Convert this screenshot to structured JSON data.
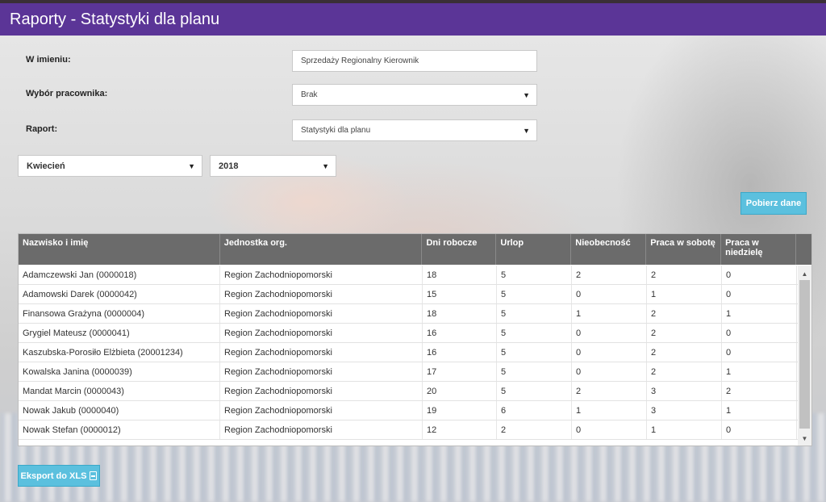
{
  "header": {
    "title": "Raporty - Statystyki dla planu"
  },
  "form": {
    "on_behalf_label": "W imieniu:",
    "on_behalf_value": "Sprzedaży Regionalny Kierownik",
    "employee_label": "Wybór pracownika:",
    "employee_value": "Brak",
    "report_label": "Raport:",
    "report_value": "Statystyki dla planu",
    "month_value": "Kwiecień",
    "year_value": "2018"
  },
  "buttons": {
    "fetch_label": "Pobierz dane",
    "export_label": "Eksport do XLS"
  },
  "table": {
    "columns": [
      "Nazwisko i imię",
      "Jednostka org.",
      "Dni robocze",
      "Urlop",
      "Nieobecność",
      "Praca w sobotę",
      "Praca w niedzielę"
    ],
    "rows": [
      [
        "Adamczewski Jan (0000018)",
        "Region Zachodniopomorski",
        "18",
        "5",
        "2",
        "2",
        "0"
      ],
      [
        "Adamowski Darek (0000042)",
        "Region Zachodniopomorski",
        "15",
        "5",
        "0",
        "1",
        "0"
      ],
      [
        "Finansowa Grażyna (0000004)",
        "Region Zachodniopomorski",
        "18",
        "5",
        "1",
        "2",
        "1"
      ],
      [
        "Grygiel Mateusz (0000041)",
        "Region Zachodniopomorski",
        "16",
        "5",
        "0",
        "2",
        "0"
      ],
      [
        "Kaszubska-Porosiło Elżbieta (20001234)",
        "Region Zachodniopomorski",
        "16",
        "5",
        "0",
        "2",
        "0"
      ],
      [
        "Kowalska Janina (0000039)",
        "Region Zachodniopomorski",
        "17",
        "5",
        "0",
        "2",
        "1"
      ],
      [
        "Mandat Marcin (0000043)",
        "Region Zachodniopomorski",
        "20",
        "5",
        "2",
        "3",
        "2"
      ],
      [
        "Nowak Jakub (0000040)",
        "Region Zachodniopomorski",
        "19",
        "6",
        "1",
        "3",
        "1"
      ],
      [
        "Nowak Stefan (0000012)",
        "Region Zachodniopomorski",
        "12",
        "2",
        "0",
        "1",
        "0"
      ]
    ]
  },
  "icons": {
    "select_arrow": "triangle-down-icon",
    "export_icon": "file-excel-icon"
  },
  "colors": {
    "header_bg": "#5b3597",
    "button_bg": "#5bc0de",
    "table_header_bg": "#6b6b6b"
  }
}
